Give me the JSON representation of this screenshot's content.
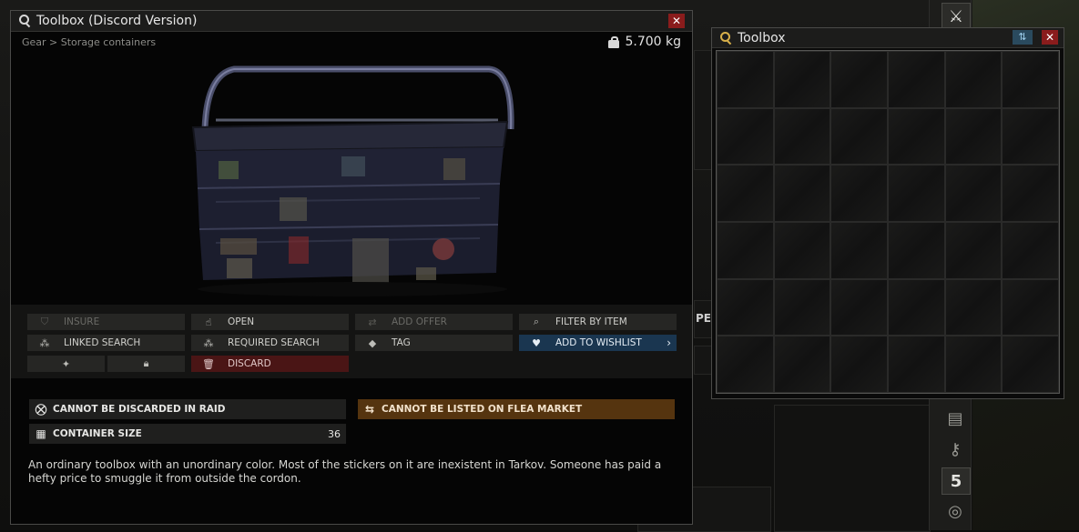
{
  "item_window": {
    "title": "Toolbox (Discord Version)",
    "close": "✕",
    "breadcrumb": "Gear > Storage containers",
    "weight": "5.700 kg",
    "actions": {
      "insure": "INSURE",
      "open": "OPEN",
      "add_offer": "ADD OFFER",
      "filter_by_item": "FILTER BY ITEM",
      "linked_search": "LINKED SEARCH",
      "required_search": "REQUIRED SEARCH",
      "tag": "TAG",
      "add_to_wishlist": "ADD TO WISHLIST",
      "discard": "DISCARD"
    },
    "properties": {
      "discard_raid": "CANNOT BE DISCARDED IN RAID",
      "flea": "CANNOT BE LISTED ON FLEA MARKET",
      "container_size_label": "CONTAINER SIZE",
      "container_size_value": "36"
    },
    "description": "An ordinary toolbox with an unordinary color. Most of the stickers on it are inexistent in Tarkov. Someone has paid a hefty price to smuggle it from outside the cordon."
  },
  "container_window": {
    "title": "Toolbox",
    "close": "✕",
    "sort": "⇅",
    "grid_columns": 6,
    "grid_rows": 6
  },
  "background": {
    "side_label": "PE",
    "side_badge": "5"
  },
  "colors": {
    "close_red": "#8a1c1c",
    "wishlist_blue": "#1a3650",
    "discard_red": "#4a1515",
    "flea_orange": "#55340f",
    "sort_blue": "#2a4a5e"
  }
}
